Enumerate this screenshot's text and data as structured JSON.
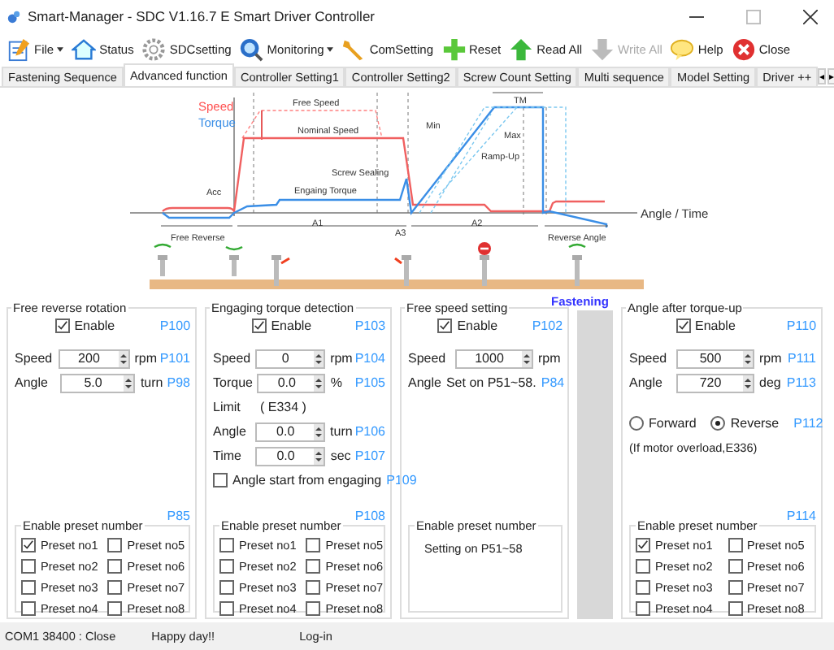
{
  "window": {
    "title": "Smart-Manager - SDC  V1.16.7 E  Smart Driver Controller"
  },
  "toolbar": [
    {
      "label": "File",
      "dropdown": true,
      "disabled": false
    },
    {
      "label": "Status",
      "dropdown": false,
      "disabled": false
    },
    {
      "label": "SDCsetting",
      "dropdown": false,
      "disabled": false
    },
    {
      "label": "Monitoring",
      "dropdown": true,
      "disabled": false
    },
    {
      "label": "ComSetting",
      "dropdown": false,
      "disabled": false
    },
    {
      "label": "Reset",
      "dropdown": false,
      "disabled": false
    },
    {
      "label": "Read All",
      "dropdown": false,
      "disabled": false
    },
    {
      "label": "Write All",
      "dropdown": false,
      "disabled": true
    },
    {
      "label": "Help",
      "dropdown": false,
      "disabled": false
    },
    {
      "label": "Close",
      "dropdown": false,
      "disabled": false
    }
  ],
  "tabs": [
    {
      "label": "Fastening Sequence",
      "selected": false
    },
    {
      "label": "Advanced function",
      "selected": true
    },
    {
      "label": "Controller Setting1",
      "selected": false
    },
    {
      "label": "Controller Setting2",
      "selected": false
    },
    {
      "label": "Screw Count Setting",
      "selected": false
    },
    {
      "label": "Multi sequence",
      "selected": false
    },
    {
      "label": "Model Setting",
      "selected": false
    },
    {
      "label": "Driver ++",
      "selected": false
    }
  ],
  "tab_scroll": [
    "◂",
    "▸"
  ],
  "diagram": {
    "labels": [
      {
        "text": "Speed",
        "kind": "speed"
      },
      {
        "text": "Torque",
        "kind": "torque"
      },
      {
        "text": "Free Speed",
        "kind": "plain"
      },
      {
        "text": "Nominal Speed",
        "kind": "plain"
      },
      {
        "text": "Screw Sealing",
        "kind": "plain"
      },
      {
        "text": "Acc",
        "kind": "plain"
      },
      {
        "text": "Engaing Torque",
        "kind": "plain"
      },
      {
        "text": "Min",
        "kind": "plain"
      },
      {
        "text": "Max",
        "kind": "plain"
      },
      {
        "text": "Ramp-Up",
        "kind": "plain"
      },
      {
        "text": "TM",
        "kind": "plain"
      },
      {
        "text": "Angle / Time",
        "kind": "axis"
      },
      {
        "text": "A1",
        "kind": "plain"
      },
      {
        "text": "A3",
        "kind": "plain"
      },
      {
        "text": "A2",
        "kind": "plain"
      },
      {
        "text": "Free Reverse",
        "kind": "plain"
      },
      {
        "text": "Reverse Angle",
        "kind": "plain"
      }
    ]
  },
  "fastening_label": "Fastening",
  "panels": [
    {
      "title": "Free reverse rotation",
      "rows": [
        {
          "kind": "enable",
          "label": "Enable",
          "checked": true,
          "code": "P100"
        },
        {
          "kind": "field",
          "label": "Speed",
          "value": "200",
          "unit": "rpm",
          "code": "P101"
        },
        {
          "kind": "field",
          "label": "Angle",
          "value": "5.0",
          "unit": "turn",
          "code": "P98"
        }
      ],
      "presets": {
        "title": "Enable preset number",
        "code": "P85",
        "items": [
          {
            "label": "Preset no1",
            "checked": true
          },
          {
            "label": "Preset no2",
            "checked": false
          },
          {
            "label": "Preset no3",
            "checked": false
          },
          {
            "label": "Preset no4",
            "checked": false
          },
          {
            "label": "Preset no5",
            "checked": false
          },
          {
            "label": "Preset no6",
            "checked": false
          },
          {
            "label": "Preset no7",
            "checked": false
          },
          {
            "label": "Preset no8",
            "checked": false
          }
        ]
      }
    },
    {
      "title": "Engaging torque detection",
      "rows": [
        {
          "kind": "enable",
          "label": "Enable",
          "checked": true,
          "code": "P103"
        },
        {
          "kind": "field",
          "label": "Speed",
          "value": "0",
          "unit": "rpm",
          "code": "P104"
        },
        {
          "kind": "field",
          "label": "Torque",
          "value": "0.0",
          "unit": "%",
          "code": "P105"
        },
        {
          "kind": "info",
          "label": "Limit",
          "value": "( E334 )"
        },
        {
          "kind": "field",
          "label": "Angle",
          "value": "0.0",
          "unit": "turn",
          "code": "P106"
        },
        {
          "kind": "field",
          "label": "Time",
          "value": "0.0",
          "unit": "sec",
          "code": "P107"
        },
        {
          "kind": "check",
          "label": "Angle start from engaging",
          "checked": false,
          "code": "P109"
        }
      ],
      "presets": {
        "title": "Enable preset number",
        "code": "P108",
        "items": [
          {
            "label": "Preset no1",
            "checked": false
          },
          {
            "label": "Preset no2",
            "checked": false
          },
          {
            "label": "Preset no3",
            "checked": false
          },
          {
            "label": "Preset no4",
            "checked": false
          },
          {
            "label": "Preset no5",
            "checked": false
          },
          {
            "label": "Preset no6",
            "checked": false
          },
          {
            "label": "Preset no7",
            "checked": false
          },
          {
            "label": "Preset no8",
            "checked": false
          }
        ]
      }
    },
    {
      "title": "Free speed setting",
      "rows": [
        {
          "kind": "enable",
          "label": "Enable",
          "checked": true,
          "code": "P102"
        },
        {
          "kind": "field",
          "label": "Speed",
          "value": "1000",
          "unit": "rpm"
        },
        {
          "kind": "info",
          "label": "Angle",
          "value": "Set on P51~58.",
          "code": "P84"
        }
      ],
      "presets": {
        "title": "Enable preset number",
        "note": "Setting on P51~58"
      }
    },
    {
      "title": "Angle after torque-up",
      "rows": [
        {
          "kind": "enable",
          "label": "Enable",
          "checked": true,
          "code": "P110"
        },
        {
          "kind": "field",
          "label": "Speed",
          "value": "500",
          "unit": "rpm",
          "code": "P111"
        },
        {
          "kind": "field",
          "label": "Angle",
          "value": "720",
          "unit": "deg",
          "code": "P113"
        },
        {
          "kind": "radios",
          "options": [
            {
              "label": "Forward",
              "selected": false
            },
            {
              "label": "Reverse",
              "selected": true
            }
          ],
          "code": "P112"
        },
        {
          "kind": "note",
          "text": "(If motor overload,E336)"
        }
      ],
      "presets": {
        "title": "Enable preset number",
        "code": "P114",
        "items": [
          {
            "label": "Preset no1",
            "checked": true
          },
          {
            "label": "Preset no2",
            "checked": false
          },
          {
            "label": "Preset no3",
            "checked": false
          },
          {
            "label": "Preset no4",
            "checked": false
          },
          {
            "label": "Preset no5",
            "checked": false
          },
          {
            "label": "Preset no6",
            "checked": false
          },
          {
            "label": "Preset no7",
            "checked": false
          },
          {
            "label": "Preset no8",
            "checked": false
          }
        ]
      }
    }
  ],
  "status_bar": [
    "COM1  38400 : Close",
    "Happy day!!",
    "Log-in"
  ]
}
